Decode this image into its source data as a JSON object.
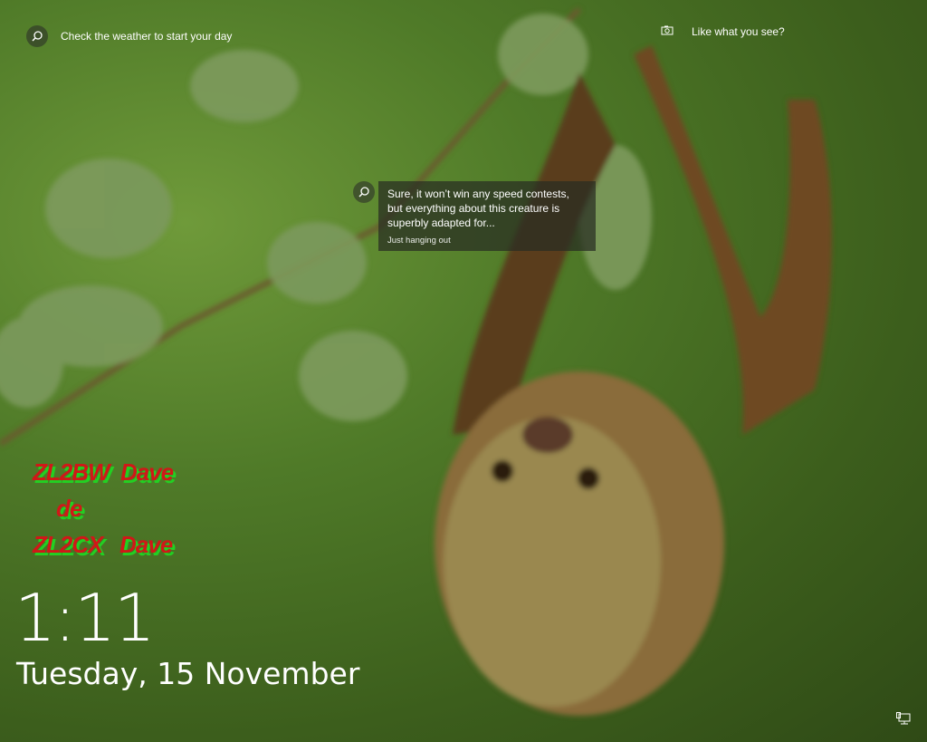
{
  "weather": {
    "icon": "search-icon",
    "label": "Check the weather to start your day"
  },
  "spotlight": {
    "icon": "camera-icon",
    "label": "Like what you see?"
  },
  "tip": {
    "text": "Sure, it won’t win any speed contests, but everything about this creature is superbly adapted for...",
    "subtitle": "Just hanging out"
  },
  "overlay": {
    "line1": "ZL2BW  Dave",
    "line2": "de",
    "line3": "ZL2CX   Dave"
  },
  "clock": {
    "time": "1:11",
    "date": "Tuesday, 15 November"
  },
  "tray": {
    "icon": "network-icon"
  }
}
